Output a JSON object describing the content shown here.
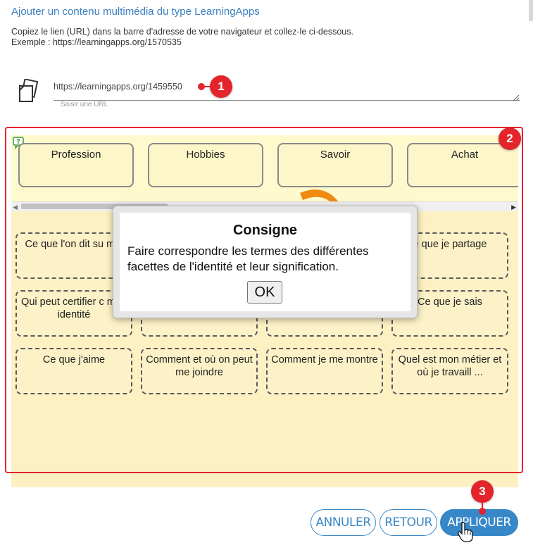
{
  "dialog": {
    "title": "Ajouter un contenu multimédia du type LearningApps",
    "instruction_line1": "Copiez le lien (URL) dans la barre d'adresse de votre navigateur et collez-le ci-dessous.",
    "instruction_line2": "Exemple : https://learningapps.org/1570535"
  },
  "url_field": {
    "value": "https://learningapps.org/1459550",
    "placeholder": "Saisir une URL",
    "icon": "copy-paste-icon"
  },
  "markers": [
    "1",
    "2",
    "3"
  ],
  "preview": {
    "help_icon": "help-question-icon",
    "categories": [
      "Profession",
      "Hobbies",
      "Savoir",
      "Achat"
    ],
    "cards": [
      "Ce que l'on dit sur moi",
      "Ce que je partage",
      "Qui peut certifier mon identité",
      "Ce que je sais",
      "Ce que j'aime",
      "Comment et où on peut me joindre",
      "Comment je me montre",
      "Quel est mon métier et où je travaill ..."
    ],
    "card_visible_text": [
      "Ce que l'on dit su moi",
      "e que je partage",
      "Qui peut certifier c mon identité",
      "Ce que je sais",
      "Ce que j'aime",
      "Comment et où on peut me joindre",
      "Comment je me montre",
      "Quel est mon métier et où je travaill ..."
    ],
    "modal": {
      "title": "Consigne",
      "body": "Faire correspondre les termes des différentes facettes de l'identité et leur signification.",
      "ok_label": "OK"
    }
  },
  "buttons": {
    "cancel": "ANNULER",
    "back": "RETOUR",
    "apply": "APPLIQUER"
  },
  "colors": {
    "accent": "#3788c8",
    "marker": "#e3242b",
    "preview_bg": "#fdf1c4"
  }
}
